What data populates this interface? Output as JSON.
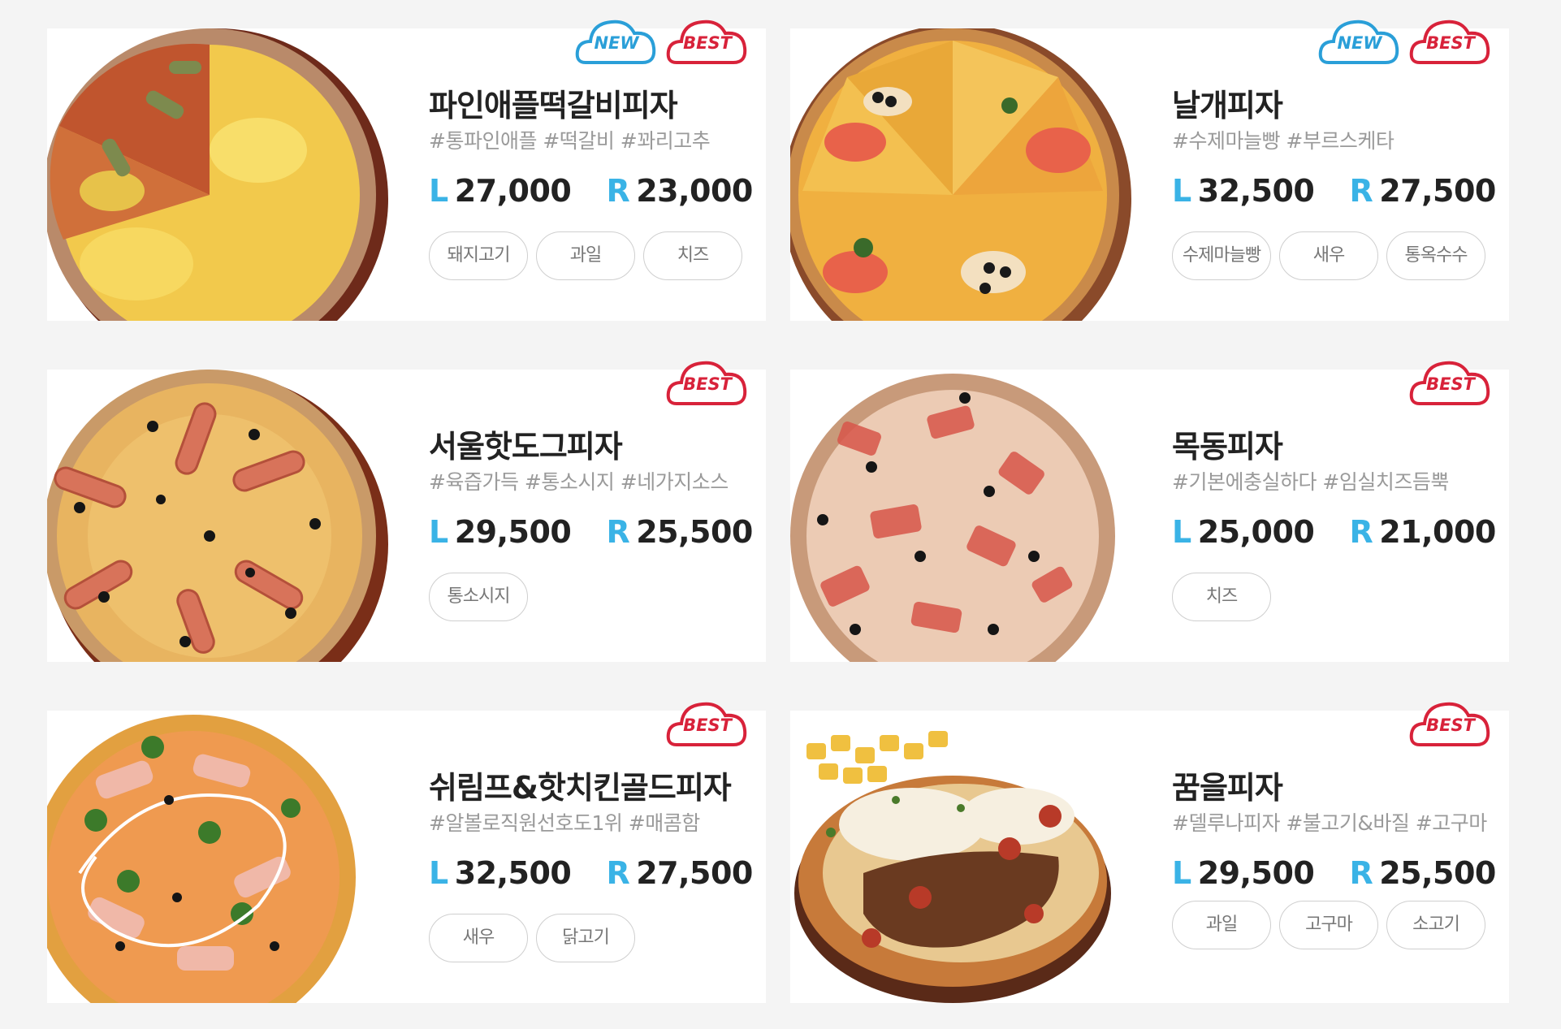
{
  "colors": {
    "size_letter": "#3ab3e6",
    "new_badge": "#2a9fd8",
    "best_badge": "#d8223a",
    "page_bg": "#f4f4f4"
  },
  "pizzas": [
    {
      "name": "파인애플떡갈비피자",
      "tags": "#통파인애플 #떡갈비 #꽈리고추",
      "price_l_label": "L",
      "price_l": "27,000",
      "price_r_label": "R",
      "price_r": "23,000",
      "badges": [
        "NEW",
        "BEST"
      ],
      "toppings": [
        "돼지고기",
        "과일",
        "치즈"
      ],
      "image_icon": "pineapple-pizza-image"
    },
    {
      "name": "날개피자",
      "tags": "#수제마늘빵 #부르스케타",
      "price_l_label": "L",
      "price_l": "32,500",
      "price_r_label": "R",
      "price_r": "27,500",
      "badges": [
        "NEW",
        "BEST"
      ],
      "toppings": [
        "수제마늘빵",
        "새우",
        "통옥수수"
      ],
      "image_icon": "wing-pizza-image"
    },
    {
      "name": "서울핫도그피자",
      "tags": "#육즙가득 #통소시지 #네가지소스",
      "price_l_label": "L",
      "price_l": "29,500",
      "price_r_label": "R",
      "price_r": "25,500",
      "badges": [
        "BEST"
      ],
      "toppings": [
        "통소시지"
      ],
      "image_icon": "hotdog-pizza-image"
    },
    {
      "name": "목동피자",
      "tags": "#기본에충실하다 #임실치즈듬뿍",
      "price_l_label": "L",
      "price_l": "25,000",
      "price_r_label": "R",
      "price_r": "21,000",
      "badges": [
        "BEST"
      ],
      "toppings": [
        "치즈"
      ],
      "image_icon": "mokdong-pizza-image"
    },
    {
      "name": "쉬림프&핫치킨골드피자",
      "tags": "#알볼로직원선호도1위 #매콤함",
      "price_l_label": "L",
      "price_l": "32,500",
      "price_r_label": "R",
      "price_r": "27,500",
      "badges": [
        "BEST"
      ],
      "toppings": [
        "새우",
        "닭고기"
      ],
      "image_icon": "shrimp-chicken-pizza-image"
    },
    {
      "name": "꿈을피자",
      "tags": "#델루나피자 #불고기&바질 #고구마",
      "price_l_label": "L",
      "price_l": "29,500",
      "price_r_label": "R",
      "price_r": "25,500",
      "badges": [
        "BEST"
      ],
      "toppings": [
        "과일",
        "고구마",
        "소고기"
      ],
      "image_icon": "dream-pizza-image"
    }
  ]
}
